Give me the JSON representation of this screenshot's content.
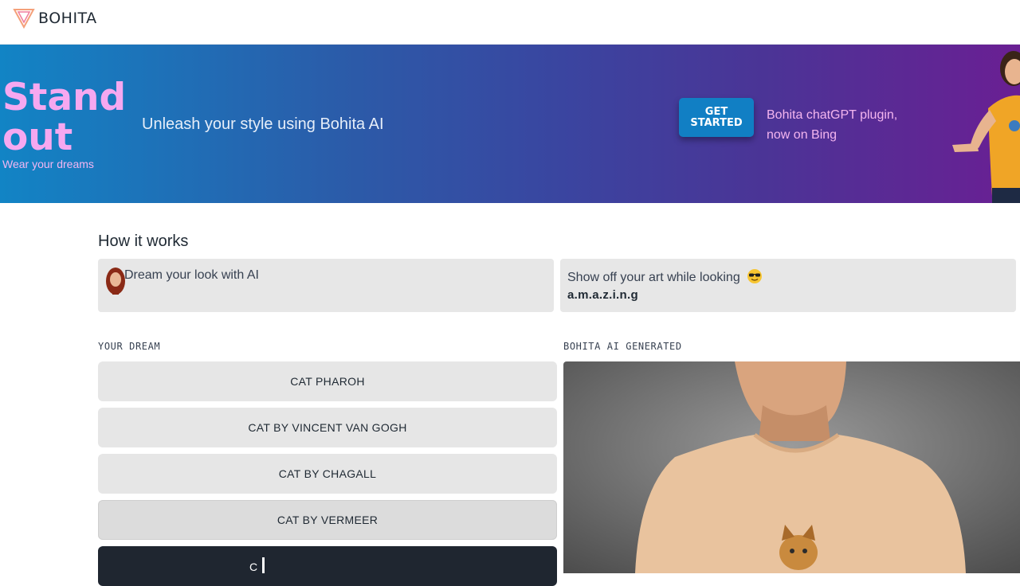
{
  "header": {
    "brand": "BOHITA"
  },
  "hero": {
    "title": "Stand out",
    "subtitle": "Wear your dreams",
    "tagline": "Unleash your style using Bohita AI",
    "cta_label": "GET STARTED",
    "plugin_text": "Bohita chatGPT plugin, now on Bing",
    "colors": {
      "gradient_start": "#1284c5",
      "gradient_end": "#6a1f93",
      "title": "#f6a8f0",
      "cta": "#117fc4"
    }
  },
  "how_it_works": {
    "title": "How it works",
    "cards": [
      {
        "text": "Dream your look with AI",
        "icon": "portrait-icon"
      },
      {
        "text": "Show off your art while looking",
        "emphasis": "a.m.a.z.i.n.g",
        "icon": "sunglasses-emoji-icon"
      }
    ]
  },
  "your_dream": {
    "label": "YOUR DREAM",
    "options": [
      "CAT PHAROH",
      "CAT BY VINCENT VAN GOGH",
      "CAT BY CHAGALL",
      "CAT BY VERMEER"
    ],
    "input_value": "C"
  },
  "generated": {
    "label": "BOHITA AI GENERATED",
    "image": "model-wearing-cat-tshirt"
  }
}
